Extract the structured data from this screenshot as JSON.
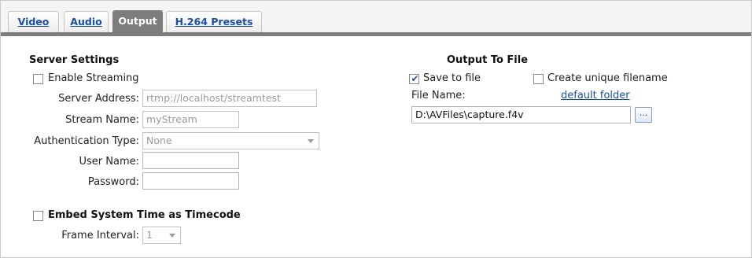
{
  "tabs": [
    {
      "label": "Video",
      "active": false
    },
    {
      "label": "Audio",
      "active": false
    },
    {
      "label": "Output",
      "active": true
    },
    {
      "label": "H.264 Presets",
      "active": false
    }
  ],
  "server_settings": {
    "heading": "Server Settings",
    "enable_streaming": {
      "label": "Enable Streaming",
      "checked": false
    },
    "server_address": {
      "label": "Server Address:",
      "value": "rtmp://localhost/streamtest"
    },
    "stream_name": {
      "label": "Stream Name:",
      "value": "myStream"
    },
    "auth_type": {
      "label": "Authentication Type:",
      "value": "None"
    },
    "user_name": {
      "label": "User Name:",
      "value": ""
    },
    "password": {
      "label": "Password:",
      "value": ""
    },
    "embed_timecode": {
      "label": "Embed System Time as Timecode",
      "checked": false
    },
    "frame_interval": {
      "label": "Frame Interval:",
      "value": "1"
    }
  },
  "output_to_file": {
    "heading": "Output To File",
    "save_to_file": {
      "label": "Save to file",
      "checked": true
    },
    "unique_filename": {
      "label": "Create unique filename",
      "checked": false
    },
    "file_name_label": "File Name:",
    "default_folder_link": "default folder",
    "file_path": "D:\\AVFiles\\capture.f4v",
    "browse_label": "..."
  },
  "colors": {
    "tab_active_bg": "#7d7d7d",
    "link": "#1a4fa3",
    "check_tick": "#2d4f99"
  },
  "icons": {
    "checkbox_check": "check-icon",
    "dropdown": "chevron-down-icon"
  }
}
